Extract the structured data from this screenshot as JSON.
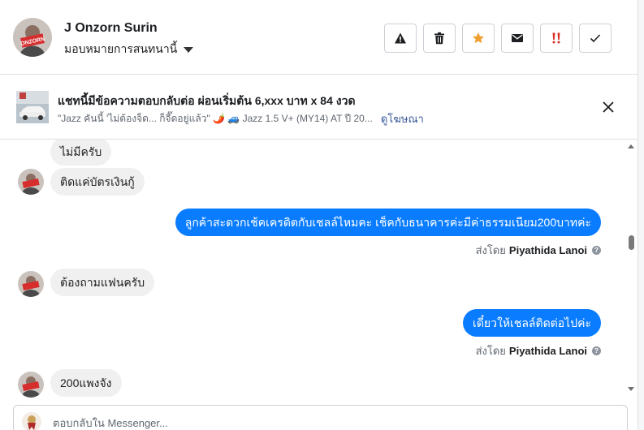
{
  "header": {
    "contact_name": "J Onzorn Surin",
    "assign_label": "มอบหมายการสนทนานี้",
    "actions": [
      {
        "name": "report-icon",
        "label": "report"
      },
      {
        "name": "trash-icon",
        "label": "delete"
      },
      {
        "name": "star-icon",
        "label": "star"
      },
      {
        "name": "mail-icon",
        "label": "mark unread"
      },
      {
        "name": "double-exclamation-icon",
        "label": "spam"
      },
      {
        "name": "check-icon",
        "label": "done"
      }
    ],
    "accent_star": "#f0a030",
    "accent_spam": "#d93025"
  },
  "ad": {
    "title": "แชทนี้มีข้อความตอบกลับต่อ ผ่อนเริ่มต้น 6,xxx บาท x 84 งวด",
    "subtitle": "\"Jazz คันนี้ 'ไม่ต้องจ็ด... ก็จี๊ดอยู่แล้ว\" 🌶️ 🚙 Jazz 1.5 V+ (MY14) AT ปี 20...",
    "link": "ดูโฆษณา"
  },
  "messages": [
    {
      "dir": "in",
      "text": "ไม่มีครับ",
      "avatar": false
    },
    {
      "dir": "in",
      "text": "ติดแค่บัตรเงินกู้",
      "avatar": true
    },
    {
      "dir": "out",
      "text": "ลูกค้าสะดวกเช้คเครดิตกับเชลล์ไหมคะ เช็คกับธนาคารค่ะมีค่าธรรมเนียม200บาทค่ะ"
    },
    {
      "dir": "meta",
      "prefix": "ส่งโดย",
      "sender": "Piyathida Lanoi"
    },
    {
      "dir": "in",
      "text": "ต้องถามแฟนครับ",
      "avatar": true
    },
    {
      "dir": "out",
      "text": "เดี๋ยวให้เชลล์ติดต่อไปค่ะ"
    },
    {
      "dir": "meta",
      "prefix": "ส่งโดย",
      "sender": "Piyathida Lanoi"
    },
    {
      "dir": "in",
      "text": "200แพงจัง",
      "avatar": true
    }
  ],
  "composer": {
    "placeholder": "ตอบกลับใน Messenger..."
  },
  "colors": {
    "outgoing_bubble": "#0a7cff",
    "incoming_bubble": "#f1f0f0",
    "link": "#385898"
  }
}
